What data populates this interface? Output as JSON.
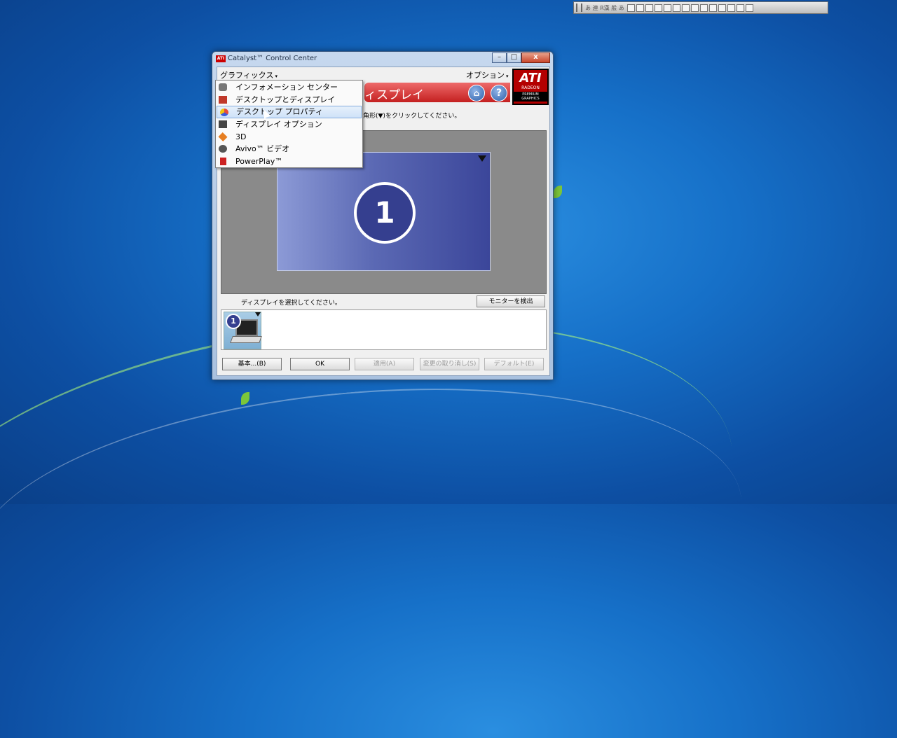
{
  "language_bar": {
    "text": "あ 連 R漢 般 あ"
  },
  "window": {
    "title": "Catalyst™ Control Center",
    "app_icon_text": "ATI",
    "min_label": "–",
    "max_label": "□",
    "close_label": "x"
  },
  "menubar": {
    "graphics_label": "グラフィックス",
    "options_label": "オプション",
    "caret": "▾"
  },
  "banner": {
    "title": "ィスプレイ",
    "home_label": "⌂",
    "help_label": "?"
  },
  "logo": {
    "brand": "ATI",
    "sub": "RADEON",
    "tag": "PREMIUM GRAPHICS"
  },
  "instruction_text": "角形(▼)をクリックしてください。",
  "preview": {
    "display_number": "1"
  },
  "select_display_text": "ディスプレイを選択してください。",
  "detect_monitor_button": "モニターを検出",
  "thumbnail": {
    "number": "1"
  },
  "buttons": {
    "basic": "基本...(B)",
    "ok": "OK",
    "apply": "適用(A)",
    "discard": "変更の取り消し(S)",
    "default": "デフォルト(E)"
  },
  "graphics_menu": {
    "items": [
      {
        "label": "インフォメーション センター",
        "icon": "info-center-icon",
        "color": "#777777"
      },
      {
        "label": "デスクトップとディスプレイ",
        "icon": "desktops-displays-icon",
        "color": "#c0392b"
      },
      {
        "label": "デスクトップ プロパティ",
        "icon": "desktop-properties-icon",
        "color": "#3b5bdb",
        "selected": true
      },
      {
        "label": "ディスプレイ オプション",
        "icon": "display-options-icon",
        "color": "#444444"
      },
      {
        "label": "3D",
        "icon": "3d-icon",
        "color": "#e67e22"
      },
      {
        "label": "Avivo™ ビデオ",
        "icon": "avivo-video-icon",
        "color": "#555555"
      },
      {
        "label": "PowerPlay™",
        "icon": "powerplay-icon",
        "color": "#cc2222"
      }
    ]
  },
  "colors": {
    "banner_red": "#c42020",
    "ati_red": "#b40000",
    "display_blue": "#353f8f",
    "menu_highlight": "#cfe2f8"
  }
}
